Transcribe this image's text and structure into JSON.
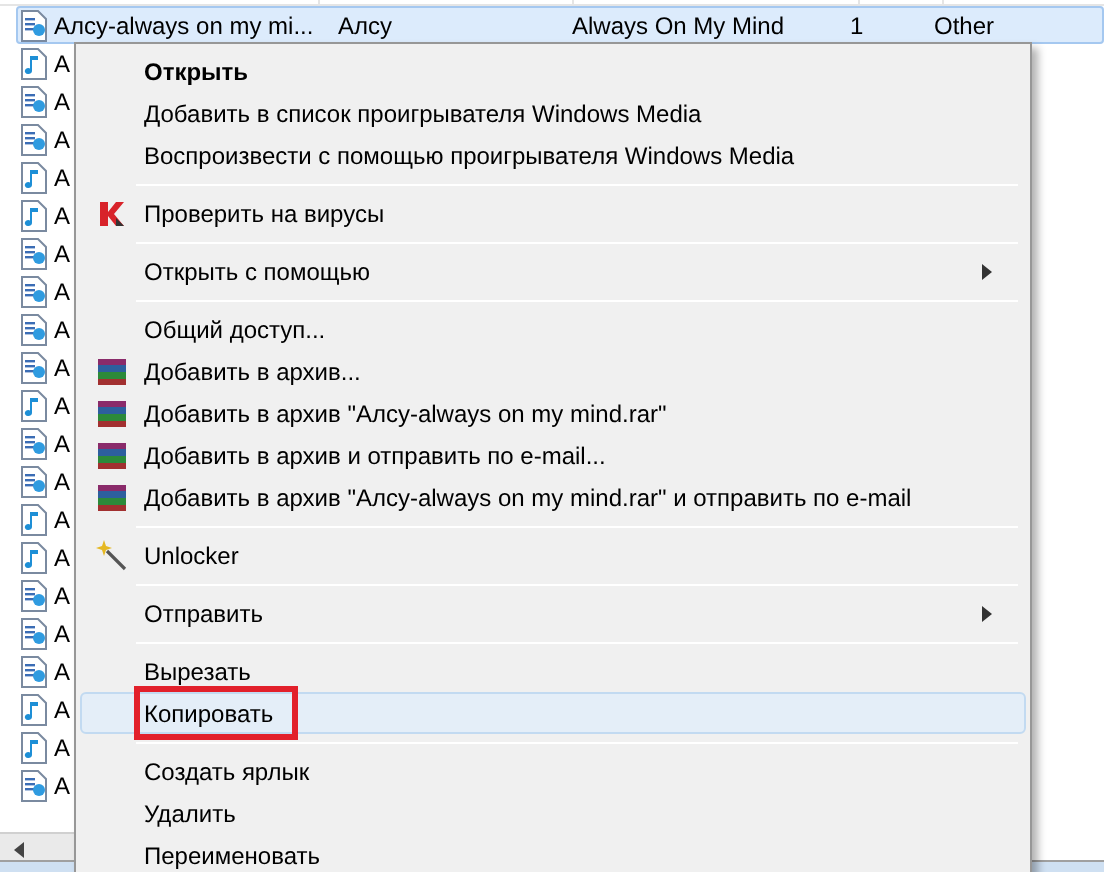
{
  "file_list": {
    "rows": [
      {
        "kind": "media",
        "selected": true,
        "cells": [
          "Алсу-always on my mi...",
          "Алсу",
          "Always On My Mind",
          "1",
          "Other"
        ]
      },
      {
        "kind": "note",
        "selected": false,
        "cells": [
          "А"
        ]
      },
      {
        "kind": "media",
        "selected": false,
        "cells": [
          "А"
        ]
      },
      {
        "kind": "media",
        "selected": false,
        "cells": [
          "А"
        ]
      },
      {
        "kind": "note",
        "selected": false,
        "cells": [
          "А"
        ]
      },
      {
        "kind": "note",
        "selected": false,
        "cells": [
          "А"
        ]
      },
      {
        "kind": "media",
        "selected": false,
        "cells": [
          "А"
        ]
      },
      {
        "kind": "media",
        "selected": false,
        "cells": [
          "А"
        ]
      },
      {
        "kind": "media",
        "selected": false,
        "cells": [
          "А"
        ]
      },
      {
        "kind": "media",
        "selected": false,
        "cells": [
          "А"
        ]
      },
      {
        "kind": "note",
        "selected": false,
        "cells": [
          "А"
        ]
      },
      {
        "kind": "media",
        "selected": false,
        "cells": [
          "А"
        ]
      },
      {
        "kind": "media",
        "selected": false,
        "cells": [
          "А"
        ]
      },
      {
        "kind": "note",
        "selected": false,
        "cells": [
          "А"
        ]
      },
      {
        "kind": "note",
        "selected": false,
        "cells": [
          "А"
        ]
      },
      {
        "kind": "media",
        "selected": false,
        "cells": [
          "А"
        ]
      },
      {
        "kind": "media",
        "selected": false,
        "cells": [
          "А"
        ]
      },
      {
        "kind": "media",
        "selected": false,
        "cells": [
          "А"
        ]
      },
      {
        "kind": "note",
        "selected": false,
        "cells": [
          "А"
        ]
      },
      {
        "kind": "note",
        "selected": false,
        "cells": [
          "А"
        ]
      },
      {
        "kind": "media",
        "selected": false,
        "cells": [
          "А"
        ]
      }
    ]
  },
  "context_menu": {
    "items": [
      {
        "kind": "item",
        "label": "Открыть",
        "bold": true,
        "submenu": false,
        "selected": false,
        "annotated": false
      },
      {
        "kind": "item",
        "label": "Добавить в список проигрывателя Windows Media",
        "bold": false,
        "submenu": false,
        "selected": false,
        "annotated": false
      },
      {
        "kind": "item",
        "label": "Воспроизвести с помощью проигрывателя Windows Media",
        "bold": false,
        "submenu": false,
        "selected": false,
        "annotated": false
      },
      {
        "kind": "separator"
      },
      {
        "kind": "antivirus",
        "label": "Проверить на вирусы",
        "bold": false,
        "submenu": false,
        "selected": false,
        "annotated": false
      },
      {
        "kind": "separator"
      },
      {
        "kind": "item",
        "label": "Открыть с помощью",
        "bold": false,
        "submenu": true,
        "selected": false,
        "annotated": false
      },
      {
        "kind": "separator"
      },
      {
        "kind": "item",
        "label": "Общий доступ...",
        "bold": false,
        "submenu": false,
        "selected": false,
        "annotated": false
      },
      {
        "kind": "archive",
        "label": "Добавить в архив...",
        "bold": false,
        "submenu": false,
        "selected": false,
        "annotated": false
      },
      {
        "kind": "archive",
        "label": "Добавить в архив \"Алсу-always on my mind.rar\"",
        "bold": false,
        "submenu": false,
        "selected": false,
        "annotated": false
      },
      {
        "kind": "archive",
        "label": "Добавить в архив и отправить по e-mail...",
        "bold": false,
        "submenu": false,
        "selected": false,
        "annotated": false
      },
      {
        "kind": "archive",
        "label": "Добавить в архив \"Алсу-always on my mind.rar\" и отправить по e-mail",
        "bold": false,
        "submenu": false,
        "selected": false,
        "annotated": false
      },
      {
        "kind": "separator"
      },
      {
        "kind": "wand",
        "label": "Unlocker",
        "bold": false,
        "submenu": false,
        "selected": false,
        "annotated": false
      },
      {
        "kind": "separator"
      },
      {
        "kind": "item",
        "label": "Отправить",
        "bold": false,
        "submenu": true,
        "selected": false,
        "annotated": false
      },
      {
        "kind": "separator"
      },
      {
        "kind": "item",
        "label": "Вырезать",
        "bold": false,
        "submenu": false,
        "selected": false,
        "annotated": false
      },
      {
        "kind": "item",
        "label": "Копировать",
        "bold": false,
        "submenu": false,
        "selected": true,
        "annotated": true
      },
      {
        "kind": "separator"
      },
      {
        "kind": "item",
        "label": "Создать ярлык",
        "bold": false,
        "submenu": false,
        "selected": false,
        "annotated": false
      },
      {
        "kind": "item",
        "label": "Удалить",
        "bold": false,
        "submenu": false,
        "selected": false,
        "annotated": false
      },
      {
        "kind": "item",
        "label": "Переименовать",
        "bold": false,
        "submenu": false,
        "selected": false,
        "annotated": false
      }
    ]
  }
}
